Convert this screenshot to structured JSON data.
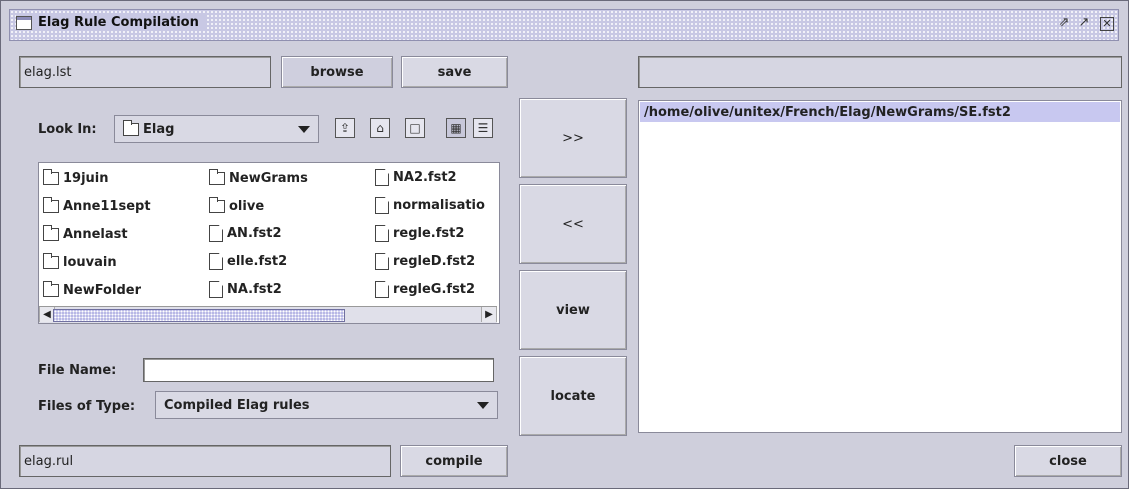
{
  "window": {
    "title": "Elag Rule Compilation",
    "controls": [
      "restore-icon",
      "maximize-icon",
      "close-icon"
    ]
  },
  "top": {
    "file_field_value": "elag.lst",
    "browse_label": "browse",
    "save_label": "save",
    "right_field_value": ""
  },
  "chooser": {
    "look_in_label": "Look In:",
    "look_in_value": "Elag",
    "files": [
      {
        "name": "19juin",
        "type": "folder"
      },
      {
        "name": "Anne11sept",
        "type": "folder"
      },
      {
        "name": "Annelast",
        "type": "folder"
      },
      {
        "name": "louvain",
        "type": "folder"
      },
      {
        "name": "NewFolder",
        "type": "folder"
      },
      {
        "name": "NewGrams",
        "type": "folder"
      },
      {
        "name": "olive",
        "type": "folder"
      },
      {
        "name": "AN.fst2",
        "type": "file"
      },
      {
        "name": "elle.fst2",
        "type": "file"
      },
      {
        "name": "NA.fst2",
        "type": "file"
      },
      {
        "name": "NA2.fst2",
        "type": "file"
      },
      {
        "name": "normalisatio",
        "type": "file"
      },
      {
        "name": "regle.fst2",
        "type": "file"
      },
      {
        "name": "regleD.fst2",
        "type": "file"
      },
      {
        "name": "regleG.fst2",
        "type": "file"
      }
    ],
    "file_name_label": "File Name:",
    "file_name_value": "",
    "files_of_type_label": "Files of Type:",
    "files_of_type_value": "Compiled Elag rules"
  },
  "middle": {
    "add_label": ">>",
    "remove_label": "<<",
    "view_label": "view",
    "locate_label": "locate"
  },
  "right": {
    "list_items": [
      "/home/olive/unitex/French/Elag/NewGrams/SE.fst2"
    ]
  },
  "bottom": {
    "output_field_value": "elag.rul",
    "compile_label": "compile",
    "close_label": "close"
  }
}
